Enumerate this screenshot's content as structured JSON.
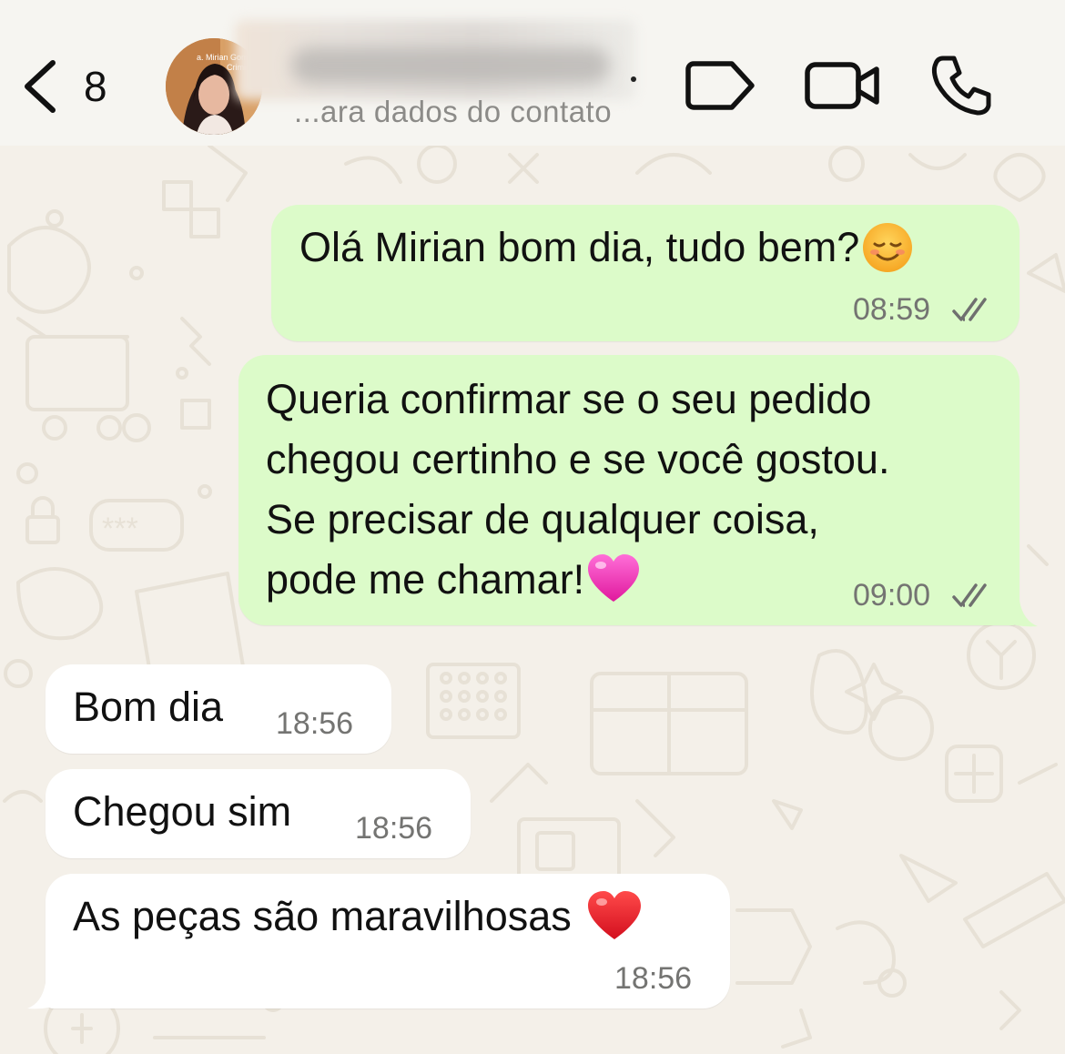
{
  "header": {
    "unread_count": "8",
    "avatar_caption": "a. Mirian Gomes Criminal",
    "contact_subtitle": "...ara dados do contato",
    "icons": [
      "chevron-left-icon",
      "tag-icon",
      "video-camera-icon",
      "phone-icon"
    ]
  },
  "messages": [
    {
      "direction": "outgoing",
      "text": "Olá Mirian bom dia, tudo bem?",
      "emoji": "smiling-face-icon",
      "time": "08:59",
      "status": "read"
    },
    {
      "direction": "outgoing",
      "lines": [
        "Queria confirmar se o seu pedido",
        "chegou certinho e se você gostou.",
        "Se precisar de qualquer coisa,",
        "pode me chamar!"
      ],
      "emoji": "pink-heart-icon",
      "time": "09:00",
      "status": "read"
    },
    {
      "direction": "incoming",
      "text": "Bom dia",
      "time": "18:56"
    },
    {
      "direction": "incoming",
      "text": "Chegou sim",
      "time": "18:56"
    },
    {
      "direction": "incoming",
      "text": "As peças são maravilhosas",
      "emoji": "red-heart-icon",
      "time": "18:56"
    }
  ],
  "colors": {
    "outgoing_bubble": "#dcfbc9",
    "incoming_bubble": "#ffffff",
    "background": "#f4f0e9",
    "timestamp": "#747472"
  }
}
